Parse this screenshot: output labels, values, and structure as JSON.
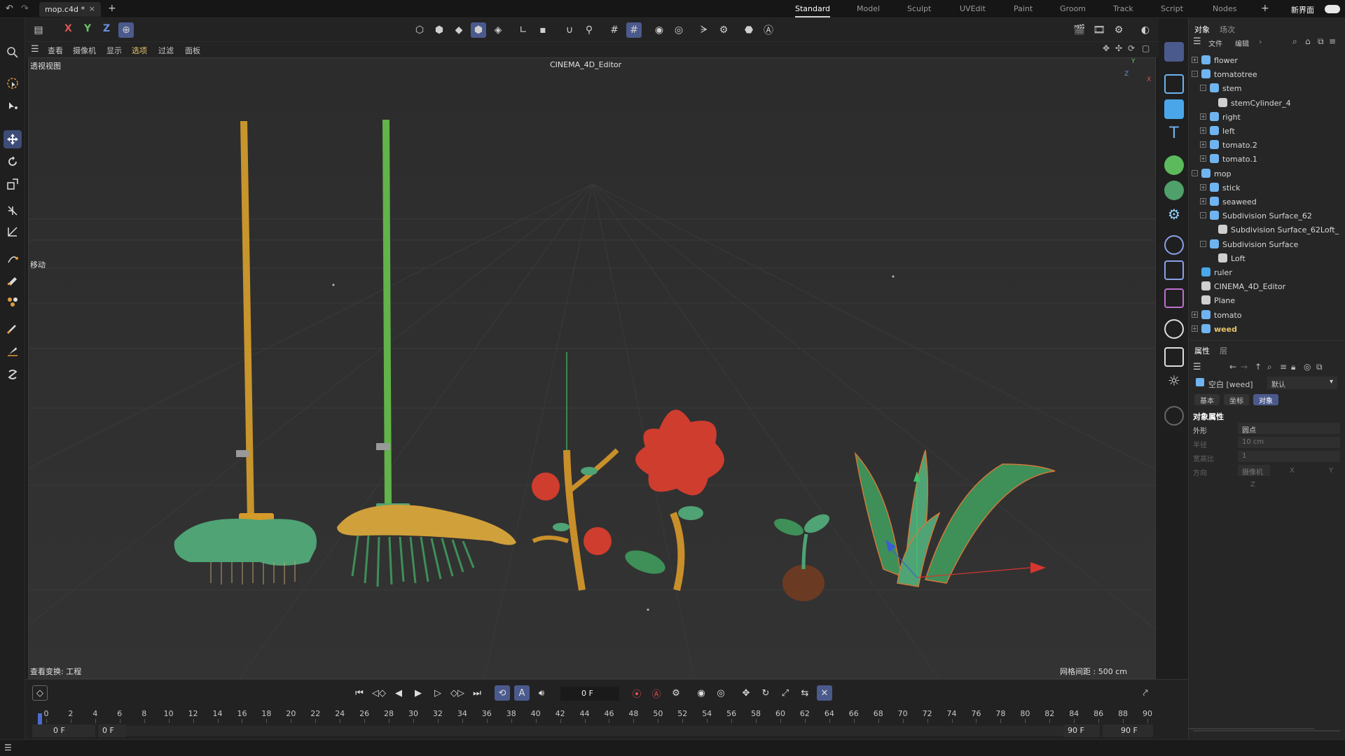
{
  "titlebar": {
    "doc_tab": "mop.c4d *",
    "layouts": [
      "Standard",
      "Model",
      "Sculpt",
      "UVEdit",
      "Paint",
      "Groom",
      "Track",
      "Script",
      "Nodes"
    ],
    "active_layout": "Standard",
    "new_ui_label": "新界面"
  },
  "toolbar": {
    "axis_x": "X",
    "axis_y": "Y",
    "axis_z": "Z"
  },
  "viewport_menu": [
    "查看",
    "摄像机",
    "显示",
    "选项",
    "过滤",
    "面板"
  ],
  "viewport": {
    "view_name": "透视视图",
    "camera_title": "CINEMA_4D_Editor",
    "tool_label": "移动",
    "view_transform": "查看变换: 工程",
    "grid_spacing": "网格间距 : 500 cm",
    "axis_y": "Y",
    "axis_x": "X",
    "axis_z": "Z"
  },
  "object_manager": {
    "tabs": [
      "对象",
      "场次"
    ],
    "menu": [
      "文件",
      "编辑"
    ],
    "objects": [
      {
        "name": "flower",
        "indent": 0,
        "expander": "+",
        "highlight": false
      },
      {
        "name": "tomatotree",
        "indent": 0,
        "expander": "-",
        "highlight": false
      },
      {
        "name": "stem",
        "indent": 1,
        "expander": "-",
        "highlight": false
      },
      {
        "name": "stemCylinder_4",
        "indent": 2,
        "expander": "",
        "highlight": false
      },
      {
        "name": "right",
        "indent": 1,
        "expander": "+",
        "highlight": false
      },
      {
        "name": "left",
        "indent": 1,
        "expander": "+",
        "highlight": false
      },
      {
        "name": "tomato.2",
        "indent": 1,
        "expander": "+",
        "highlight": false
      },
      {
        "name": "tomato.1",
        "indent": 1,
        "expander": "+",
        "highlight": false
      },
      {
        "name": "mop",
        "indent": 0,
        "expander": "-",
        "highlight": false
      },
      {
        "name": "stick",
        "indent": 1,
        "expander": "+",
        "highlight": false
      },
      {
        "name": "seaweed",
        "indent": 1,
        "expander": "+",
        "highlight": false
      },
      {
        "name": "Subdivision Surface_62",
        "indent": 1,
        "expander": "-",
        "highlight": false
      },
      {
        "name": "Subdivision Surface_62Loft_",
        "indent": 2,
        "expander": "",
        "highlight": false
      },
      {
        "name": "Subdivision Surface",
        "indent": 1,
        "expander": "-",
        "highlight": false
      },
      {
        "name": "Loft",
        "indent": 2,
        "expander": "",
        "highlight": false
      },
      {
        "name": "ruler",
        "indent": 0,
        "expander": "",
        "highlight": false
      },
      {
        "name": "CINEMA_4D_Editor",
        "indent": 0,
        "expander": "",
        "highlight": false
      },
      {
        "name": "Plane",
        "indent": 0,
        "expander": "",
        "highlight": false
      },
      {
        "name": "tomato",
        "indent": 0,
        "expander": "+",
        "highlight": false
      },
      {
        "name": "weed",
        "indent": 0,
        "expander": "+",
        "highlight": true
      }
    ]
  },
  "attribute_manager": {
    "tabs": [
      "属性",
      "层"
    ],
    "object_label": "空白 [weed]",
    "preset": "默认",
    "subtabs": [
      "基本",
      "坐标",
      "对象"
    ],
    "active_subtab": "对象",
    "section_title": "对象属性",
    "props": {
      "shape_label": "外形",
      "shape_value": "圆点",
      "radius_label": "半径",
      "radius_value": "10 cm",
      "aspect_label": "宽高比",
      "aspect_value": "1",
      "orient_label": "方向",
      "orient_value": "摄像机",
      "orient_x": "X",
      "orient_y": "Y",
      "orient_z": "Z"
    }
  },
  "timeline": {
    "current_frame": "0 F",
    "ticks": [
      "0",
      "2",
      "4",
      "6",
      "8",
      "10",
      "12",
      "14",
      "16",
      "18",
      "20",
      "22",
      "24",
      "26",
      "28",
      "30",
      "32",
      "34",
      "36",
      "38",
      "40",
      "42",
      "44",
      "46",
      "48",
      "50",
      "52",
      "54",
      "56",
      "58",
      "60",
      "62",
      "64",
      "66",
      "68",
      "70",
      "72",
      "74",
      "76",
      "78",
      "80",
      "82",
      "84",
      "86",
      "88",
      "90"
    ],
    "start_frame": "0 F",
    "start_frame2": "0 F",
    "end_frame": "90 F",
    "end_frame2": "90 F"
  },
  "colors": {
    "accent": "#4b5a8c",
    "highlight_text": "#e8c36a",
    "viewport_bg": "#2e2e2e"
  }
}
